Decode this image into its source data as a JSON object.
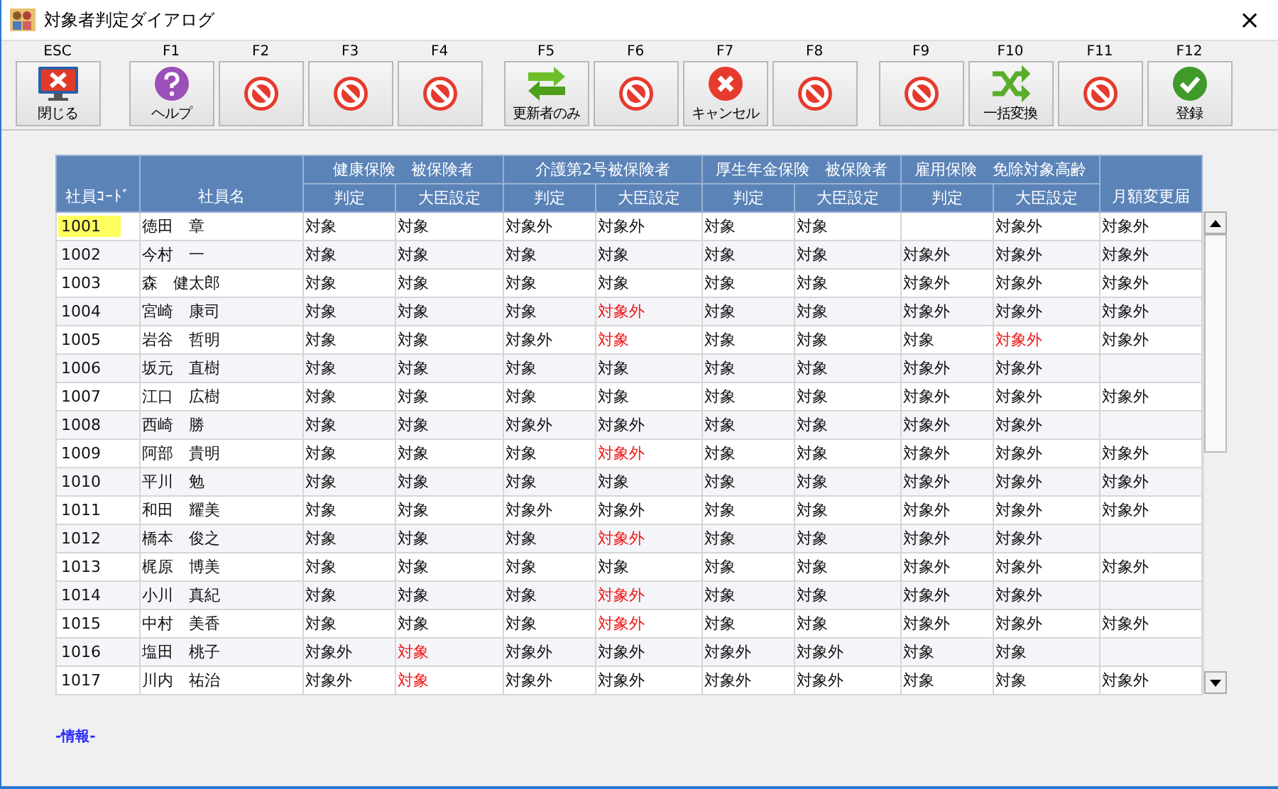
{
  "window": {
    "title": "対象者判定ダイアログ",
    "close": "×"
  },
  "toolbar_groups": [
    [
      {
        "key": "ESC",
        "kind": "exit",
        "label": "閉じる"
      }
    ],
    [
      {
        "key": "F1",
        "kind": "help",
        "label": "ヘルプ"
      },
      {
        "key": "F2",
        "kind": "prohibited"
      },
      {
        "key": "F3",
        "kind": "prohibited"
      },
      {
        "key": "F4",
        "kind": "prohibited"
      }
    ],
    [
      {
        "key": "F5",
        "kind": "swap",
        "label": "更新者のみ"
      },
      {
        "key": "F6",
        "kind": "prohibited"
      },
      {
        "key": "F7",
        "kind": "cancel",
        "label": "キャンセル"
      },
      {
        "key": "F8",
        "kind": "prohibited"
      }
    ],
    [
      {
        "key": "F9",
        "kind": "prohibited"
      },
      {
        "key": "F10",
        "kind": "shuffle",
        "label": "一括変換"
      },
      {
        "key": "F11",
        "kind": "prohibited"
      },
      {
        "key": "F12",
        "kind": "ok",
        "label": "登録"
      }
    ]
  ],
  "table": {
    "code_header": "社員ｺｰﾄﾞ",
    "name_header": "社員名",
    "groups": [
      {
        "title": "健康保険　被保険者",
        "columns": [
          "判定",
          "大臣設定"
        ]
      },
      {
        "title": "介護第2号被保険者",
        "columns": [
          "判定",
          "大臣設定"
        ]
      },
      {
        "title": "厚生年金保険　被保険者",
        "columns": [
          "判定",
          "大臣設定"
        ]
      },
      {
        "title": "雇用保険　免除対象高齢",
        "columns": [
          "判定",
          "大臣設定"
        ]
      }
    ],
    "last_header": "月額変更届",
    "rows": [
      {
        "code": "1001",
        "name": "徳田　章",
        "selected": true,
        "cells": [
          {
            "text": "対象",
            "alert": false
          },
          {
            "text": "対象",
            "alert": false
          },
          {
            "text": "対象外",
            "alert": false
          },
          {
            "text": "対象外",
            "alert": false
          },
          {
            "text": "対象",
            "alert": false
          },
          {
            "text": "対象",
            "alert": false
          },
          null,
          {
            "text": "対象外",
            "alert": false
          },
          {
            "text": "対象外",
            "alert": false
          }
        ]
      },
      {
        "code": "1002",
        "name": "今村　一",
        "selected": false,
        "cells": [
          {
            "text": "対象",
            "alert": false
          },
          {
            "text": "対象",
            "alert": false
          },
          {
            "text": "対象",
            "alert": false
          },
          {
            "text": "対象",
            "alert": false
          },
          {
            "text": "対象",
            "alert": false
          },
          {
            "text": "対象",
            "alert": false
          },
          {
            "text": "対象外",
            "alert": false
          },
          {
            "text": "対象外",
            "alert": false
          },
          {
            "text": "対象外",
            "alert": false
          }
        ]
      },
      {
        "code": "1003",
        "name": "森　健太郎",
        "selected": false,
        "cells": [
          {
            "text": "対象",
            "alert": false
          },
          {
            "text": "対象",
            "alert": false
          },
          {
            "text": "対象",
            "alert": false
          },
          {
            "text": "対象",
            "alert": false
          },
          {
            "text": "対象",
            "alert": false
          },
          {
            "text": "対象",
            "alert": false
          },
          {
            "text": "対象外",
            "alert": false
          },
          {
            "text": "対象外",
            "alert": false
          },
          {
            "text": "対象外",
            "alert": false
          }
        ]
      },
      {
        "code": "1004",
        "name": "宮崎　康司",
        "selected": false,
        "cells": [
          {
            "text": "対象",
            "alert": false
          },
          {
            "text": "対象",
            "alert": false
          },
          {
            "text": "対象",
            "alert": false
          },
          {
            "text": "対象外",
            "alert": true
          },
          {
            "text": "対象",
            "alert": false
          },
          {
            "text": "対象",
            "alert": false
          },
          {
            "text": "対象外",
            "alert": false
          },
          {
            "text": "対象外",
            "alert": false
          },
          {
            "text": "対象外",
            "alert": false
          }
        ]
      },
      {
        "code": "1005",
        "name": "岩谷　哲明",
        "selected": false,
        "cells": [
          {
            "text": "対象",
            "alert": false
          },
          {
            "text": "対象",
            "alert": false
          },
          {
            "text": "対象外",
            "alert": false
          },
          {
            "text": "対象",
            "alert": true
          },
          {
            "text": "対象",
            "alert": false
          },
          {
            "text": "対象",
            "alert": false
          },
          {
            "text": "対象",
            "alert": false
          },
          {
            "text": "対象外",
            "alert": true
          },
          {
            "text": "対象外",
            "alert": false
          }
        ]
      },
      {
        "code": "1006",
        "name": "坂元　直樹",
        "selected": false,
        "cells": [
          {
            "text": "対象",
            "alert": false
          },
          {
            "text": "対象",
            "alert": false
          },
          {
            "text": "対象",
            "alert": false
          },
          {
            "text": "対象",
            "alert": false
          },
          {
            "text": "対象",
            "alert": false
          },
          {
            "text": "対象",
            "alert": false
          },
          {
            "text": "対象外",
            "alert": false
          },
          {
            "text": "対象外",
            "alert": false
          },
          null
        ]
      },
      {
        "code": "1007",
        "name": "江口　広樹",
        "selected": false,
        "cells": [
          {
            "text": "対象",
            "alert": false
          },
          {
            "text": "対象",
            "alert": false
          },
          {
            "text": "対象",
            "alert": false
          },
          {
            "text": "対象",
            "alert": false
          },
          {
            "text": "対象",
            "alert": false
          },
          {
            "text": "対象",
            "alert": false
          },
          {
            "text": "対象外",
            "alert": false
          },
          {
            "text": "対象外",
            "alert": false
          },
          {
            "text": "対象外",
            "alert": false
          }
        ]
      },
      {
        "code": "1008",
        "name": "西崎　勝",
        "selected": false,
        "cells": [
          {
            "text": "対象",
            "alert": false
          },
          {
            "text": "対象",
            "alert": false
          },
          {
            "text": "対象外",
            "alert": false
          },
          {
            "text": "対象外",
            "alert": false
          },
          {
            "text": "対象",
            "alert": false
          },
          {
            "text": "対象",
            "alert": false
          },
          {
            "text": "対象外",
            "alert": false
          },
          {
            "text": "対象外",
            "alert": false
          },
          null
        ]
      },
      {
        "code": "1009",
        "name": "阿部　貴明",
        "selected": false,
        "cells": [
          {
            "text": "対象",
            "alert": false
          },
          {
            "text": "対象",
            "alert": false
          },
          {
            "text": "対象",
            "alert": false
          },
          {
            "text": "対象外",
            "alert": true
          },
          {
            "text": "対象",
            "alert": false
          },
          {
            "text": "対象",
            "alert": false
          },
          {
            "text": "対象外",
            "alert": false
          },
          {
            "text": "対象外",
            "alert": false
          },
          {
            "text": "対象外",
            "alert": false
          }
        ]
      },
      {
        "code": "1010",
        "name": "平川　勉",
        "selected": false,
        "cells": [
          {
            "text": "対象",
            "alert": false
          },
          {
            "text": "対象",
            "alert": false
          },
          {
            "text": "対象",
            "alert": false
          },
          {
            "text": "対象",
            "alert": false
          },
          {
            "text": "対象",
            "alert": false
          },
          {
            "text": "対象",
            "alert": false
          },
          {
            "text": "対象外",
            "alert": false
          },
          {
            "text": "対象外",
            "alert": false
          },
          {
            "text": "対象外",
            "alert": false
          }
        ]
      },
      {
        "code": "1011",
        "name": "和田　耀美",
        "selected": false,
        "cells": [
          {
            "text": "対象",
            "alert": false
          },
          {
            "text": "対象",
            "alert": false
          },
          {
            "text": "対象外",
            "alert": false
          },
          {
            "text": "対象外",
            "alert": false
          },
          {
            "text": "対象",
            "alert": false
          },
          {
            "text": "対象",
            "alert": false
          },
          {
            "text": "対象外",
            "alert": false
          },
          {
            "text": "対象外",
            "alert": false
          },
          {
            "text": "対象外",
            "alert": false
          }
        ]
      },
      {
        "code": "1012",
        "name": "橋本　俊之",
        "selected": false,
        "cells": [
          {
            "text": "対象",
            "alert": false
          },
          {
            "text": "対象",
            "alert": false
          },
          {
            "text": "対象",
            "alert": false
          },
          {
            "text": "対象外",
            "alert": true
          },
          {
            "text": "対象",
            "alert": false
          },
          {
            "text": "対象",
            "alert": false
          },
          {
            "text": "対象外",
            "alert": false
          },
          {
            "text": "対象外",
            "alert": false
          },
          null
        ]
      },
      {
        "code": "1013",
        "name": "梶原　博美",
        "selected": false,
        "cells": [
          {
            "text": "対象",
            "alert": false
          },
          {
            "text": "対象",
            "alert": false
          },
          {
            "text": "対象",
            "alert": false
          },
          {
            "text": "対象",
            "alert": false
          },
          {
            "text": "対象",
            "alert": false
          },
          {
            "text": "対象",
            "alert": false
          },
          {
            "text": "対象外",
            "alert": false
          },
          {
            "text": "対象外",
            "alert": false
          },
          {
            "text": "対象外",
            "alert": false
          }
        ]
      },
      {
        "code": "1014",
        "name": "小川　真紀",
        "selected": false,
        "cells": [
          {
            "text": "対象",
            "alert": false
          },
          {
            "text": "対象",
            "alert": false
          },
          {
            "text": "対象",
            "alert": false
          },
          {
            "text": "対象外",
            "alert": true
          },
          {
            "text": "対象",
            "alert": false
          },
          {
            "text": "対象",
            "alert": false
          },
          {
            "text": "対象外",
            "alert": false
          },
          {
            "text": "対象外",
            "alert": false
          },
          null
        ]
      },
      {
        "code": "1015",
        "name": "中村　美香",
        "selected": false,
        "cells": [
          {
            "text": "対象",
            "alert": false
          },
          {
            "text": "対象",
            "alert": false
          },
          {
            "text": "対象",
            "alert": false
          },
          {
            "text": "対象外",
            "alert": true
          },
          {
            "text": "対象",
            "alert": false
          },
          {
            "text": "対象",
            "alert": false
          },
          {
            "text": "対象外",
            "alert": false
          },
          {
            "text": "対象外",
            "alert": false
          },
          {
            "text": "対象外",
            "alert": false
          }
        ]
      },
      {
        "code": "1016",
        "name": "塩田　桃子",
        "selected": false,
        "cells": [
          {
            "text": "対象外",
            "alert": false
          },
          {
            "text": "対象",
            "alert": true
          },
          {
            "text": "対象外",
            "alert": false
          },
          {
            "text": "対象外",
            "alert": false
          },
          {
            "text": "対象外",
            "alert": false
          },
          {
            "text": "対象外",
            "alert": false
          },
          {
            "text": "対象",
            "alert": false
          },
          {
            "text": "対象",
            "alert": false
          },
          null
        ]
      },
      {
        "code": "1017",
        "name": "川内　祐治",
        "selected": false,
        "cells": [
          {
            "text": "対象外",
            "alert": false
          },
          {
            "text": "対象",
            "alert": true
          },
          {
            "text": "対象外",
            "alert": false
          },
          {
            "text": "対象外",
            "alert": false
          },
          {
            "text": "対象外",
            "alert": false
          },
          {
            "text": "対象外",
            "alert": false
          },
          {
            "text": "対象",
            "alert": false
          },
          {
            "text": "対象",
            "alert": false
          },
          {
            "text": "対象外",
            "alert": false
          }
        ]
      }
    ]
  },
  "info": "-情報-"
}
